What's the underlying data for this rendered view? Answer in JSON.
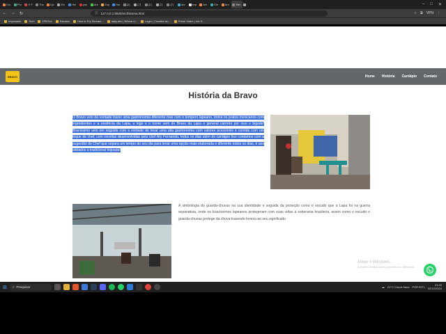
{
  "browser": {
    "tabs": [
      "Cru",
      "Pro",
      "O F",
      "The",
      "Cjn",
      "Eni",
      "Hel",
      "you",
      "Ure",
      "Exp",
      "Hor",
      "(2)",
      "(7)",
      "(2)",
      "(7)",
      "(7)",
      "dor",
      "exp",
      "Ani",
      "Cin",
      "Ani",
      "Gel",
      ""
    ],
    "url": "127.0.0.1:5500/src/historia.html",
    "ext_label": "VPN"
  },
  "bookmarks": [
    "Importado",
    "Tech",
    "CRIOco",
    "Estudos",
    "How to Fry Scream...",
    "daily.dev | Where d...",
    "Login | Creative do...",
    "Prime Video | Ver fi..."
  ],
  "site": {
    "logo_text": "BRAVO",
    "nav": [
      "Home",
      "História",
      "Cardápio",
      "Contato"
    ],
    "title": "História da Bravo",
    "para1": "O Bravo veio da vontade trazer uma gastronomia diferente mas com o tempero lapeano, todos os pratos mexicanos com ingredientes e a essência da Lapa, a logo e o nome vem do Bravo da Lapa o general carreiro por isso o bigode! Bravíssimo veio em seguida com a vontade de levar uma alta gastronomia com valores acessíveis e comida com um toque de chef, com receitas desenvolvidas pelo chef Ary Fernando, todos os dias além do cardápio fixo contamos com a sugestão do Chef que separa um tempo do seu dia para levar uma opção mais elaborada e diferente todos os dias, é aos sábados a tradicional feijoada!",
    "para2": "A simbologia do guarda-chuvas na sua identidade e seguida da proteção como o escudo que a Lapa foi na guerra separatista, onde os bravíssimos lapeanos protegeram com suas vidas a soberania brasileira, assim como o escudo o guarda-chuvas protege da chuva trazendo leveza ao seu significado"
  },
  "windows_watermark": {
    "line1": "Ativar o Windows",
    "line2": "Acesse Configurações para ativar o Windows."
  },
  "taskbar": {
    "search_placeholder": "Pesquisar",
    "weather": "21°C  Chuva fraca",
    "lang": "POR INTL",
    "time": "21:42",
    "date": "02/12/2024"
  },
  "colors": {
    "header_bg": "#62676a",
    "logo_bg": "#f2c418",
    "selection": "#3b6ed8",
    "whatsapp": "#25d366"
  }
}
